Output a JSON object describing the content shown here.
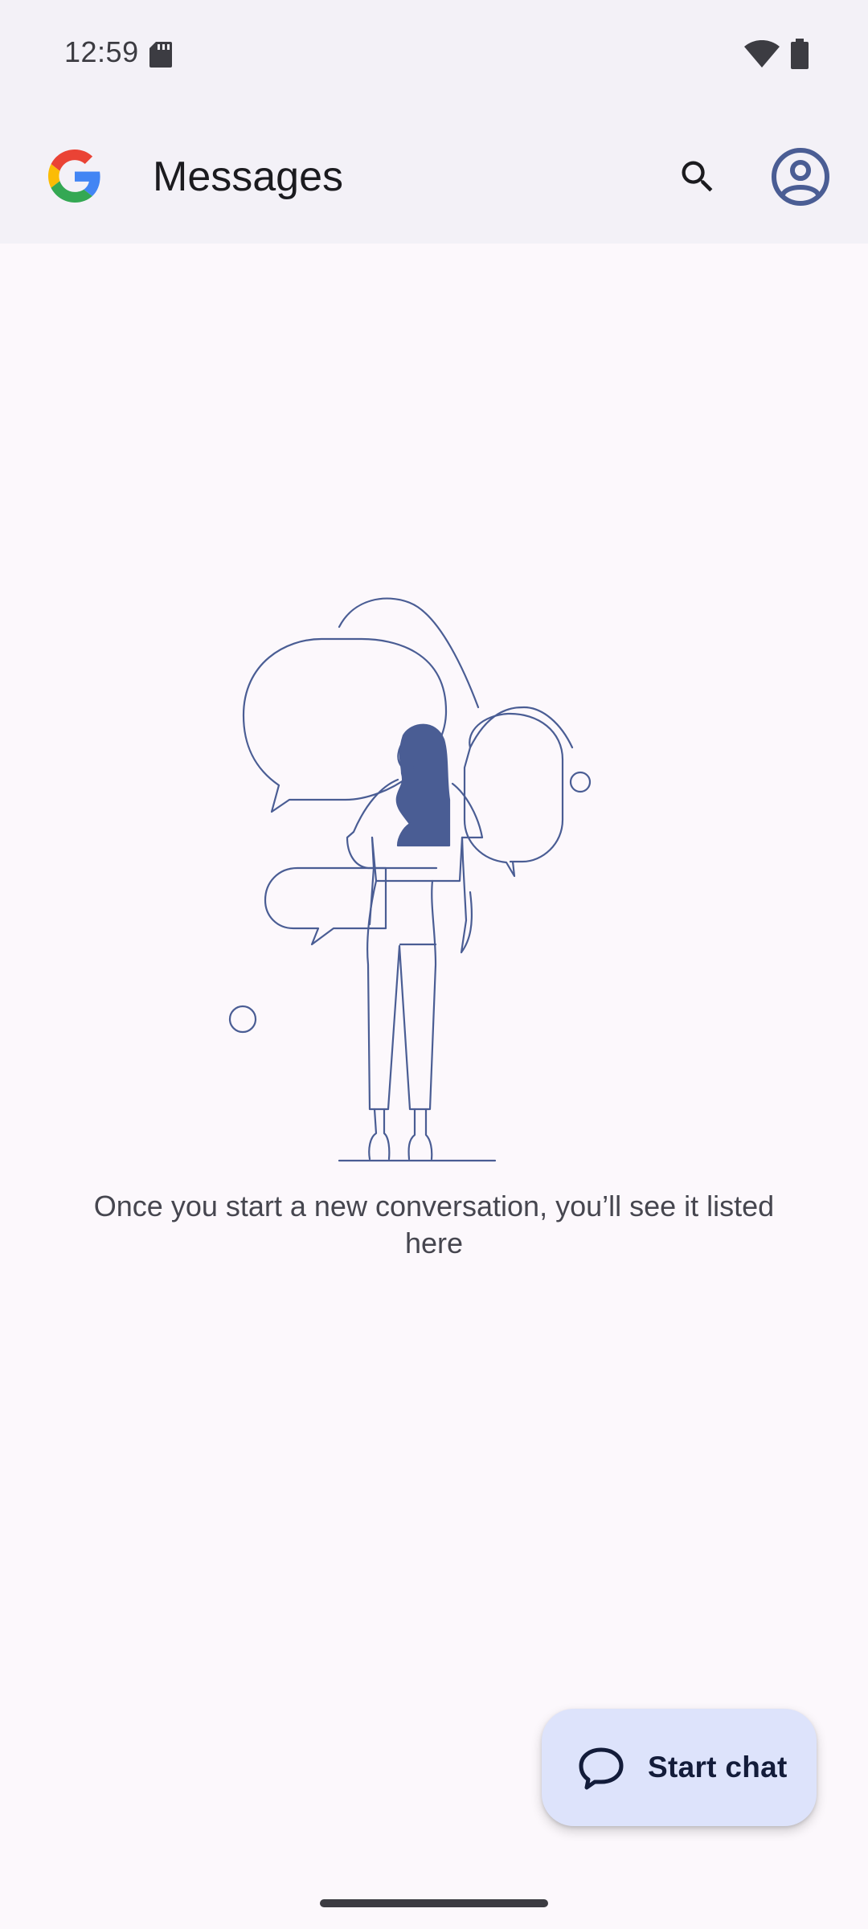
{
  "status_bar": {
    "time": "12:59"
  },
  "app_bar": {
    "title": "Messages",
    "search_icon": "search-icon",
    "account_icon": "account-circle-icon"
  },
  "empty_state": {
    "message": "Once you start a new conversation, you’ll see it listed here"
  },
  "fab": {
    "label": "Start chat",
    "icon": "chat-bubble-icon"
  },
  "colors": {
    "accent": "#4a5d94",
    "fab_bg": "#dde3fb",
    "bar_bg": "#f3f1f7",
    "page_bg": "#fcf8fc"
  }
}
